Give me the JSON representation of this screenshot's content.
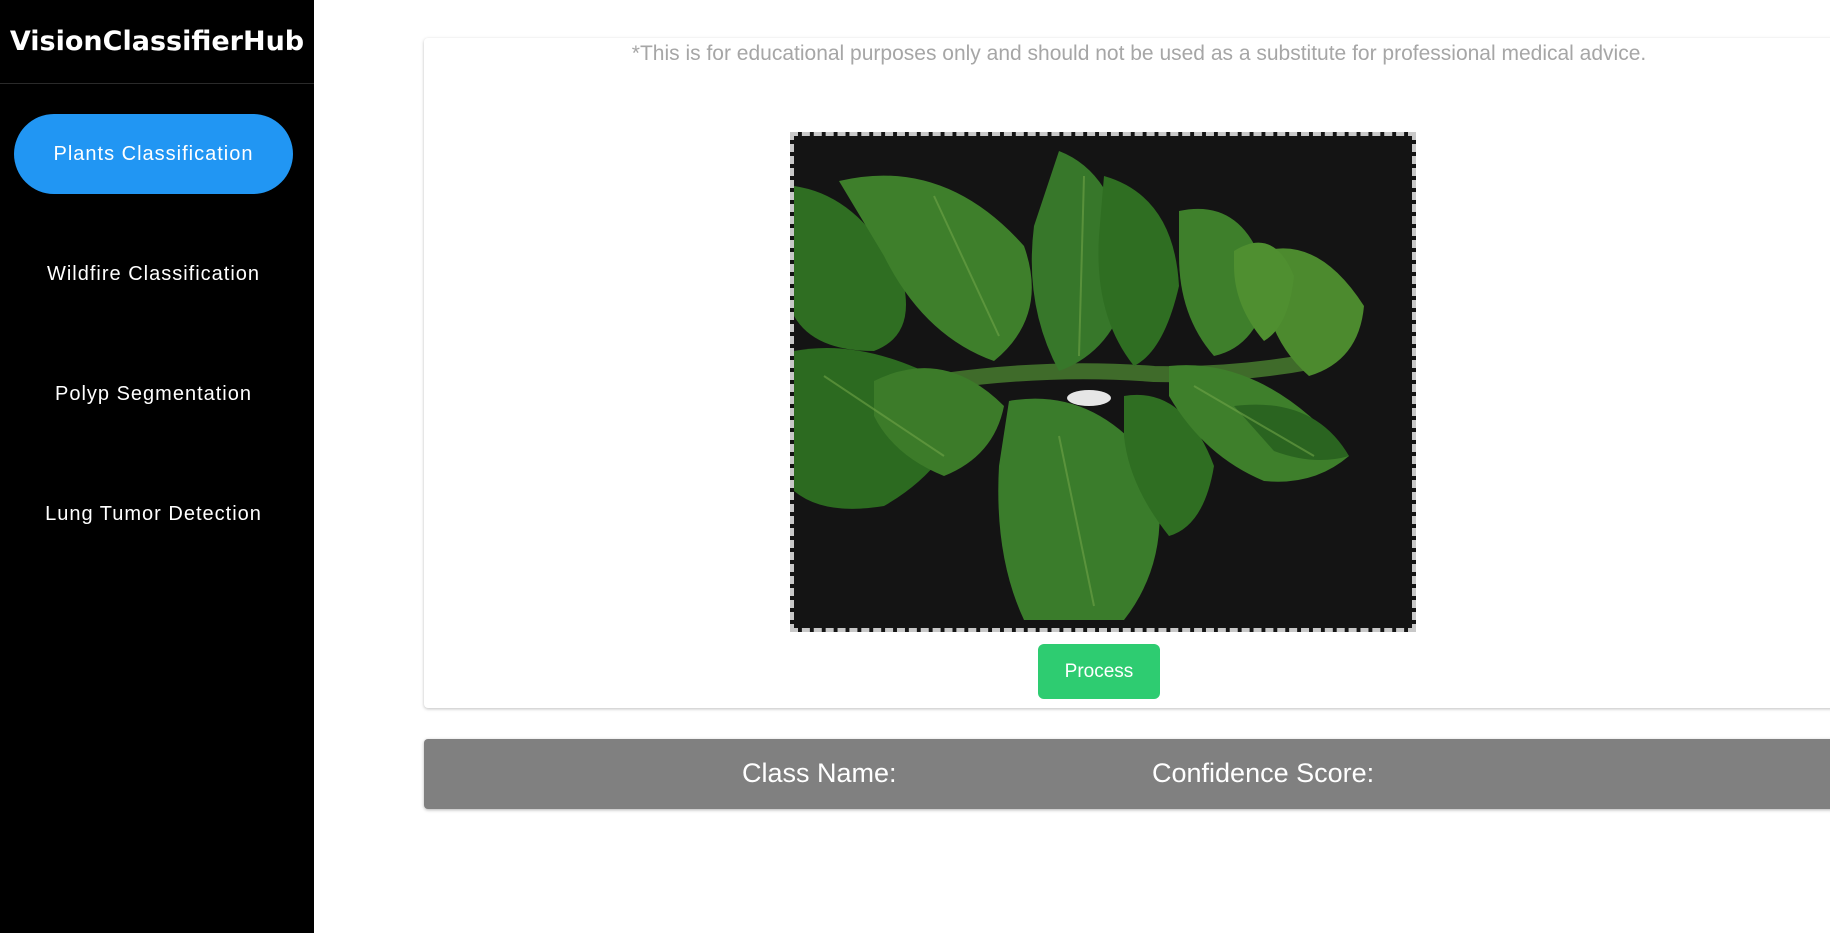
{
  "app": {
    "brand": "VisionClassifierHub"
  },
  "sidebar": {
    "items": [
      {
        "label": "Plants Classification",
        "active": true
      },
      {
        "label": "Wildfire Classification",
        "active": false
      },
      {
        "label": "Polyp Segmentation",
        "active": false
      },
      {
        "label": "Lung Tumor Detection",
        "active": false
      }
    ]
  },
  "main": {
    "disclaimer": "*This is for educational purposes only and should not be used as a substitute for professional medical advice.",
    "upload": {
      "image_icon": "plant-leaves-image"
    },
    "process_label": "Process"
  },
  "results": {
    "class_name_label": "Class Name:",
    "confidence_label": "Confidence Score:"
  },
  "colors": {
    "sidebar_bg": "#000000",
    "active_nav": "#2196f3",
    "process_button": "#2ecc71",
    "results_bar": "#808080",
    "disclaimer_text": "#a6a6a6"
  }
}
